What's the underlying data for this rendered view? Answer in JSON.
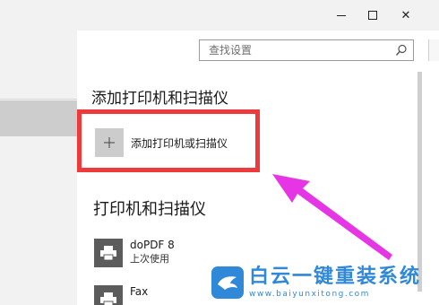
{
  "window": {
    "minimize_glyph": "—",
    "close_glyph": "✕"
  },
  "search": {
    "placeholder": "查找设置",
    "icon": "search-icon"
  },
  "sections": {
    "add_heading": "添加打印机和扫描仪",
    "add_button_label": "添加打印机或扫描仪",
    "add_icon": "plus-icon",
    "printers_heading": "打印机和扫描仪"
  },
  "printers": [
    {
      "name": "doPDF 8",
      "status": "上次使用",
      "icon": "printer-icon"
    },
    {
      "name": "Fax",
      "status": "",
      "icon": "printer-icon"
    }
  ],
  "annotation": {
    "highlight_color": "#ee3a3a",
    "arrow_color": "#e535e5"
  },
  "watermark": {
    "main": "白云一键重装系统",
    "url": "www.baiyunxitong.com",
    "color": "#2f89d8",
    "icon": "bird-logo-icon"
  }
}
